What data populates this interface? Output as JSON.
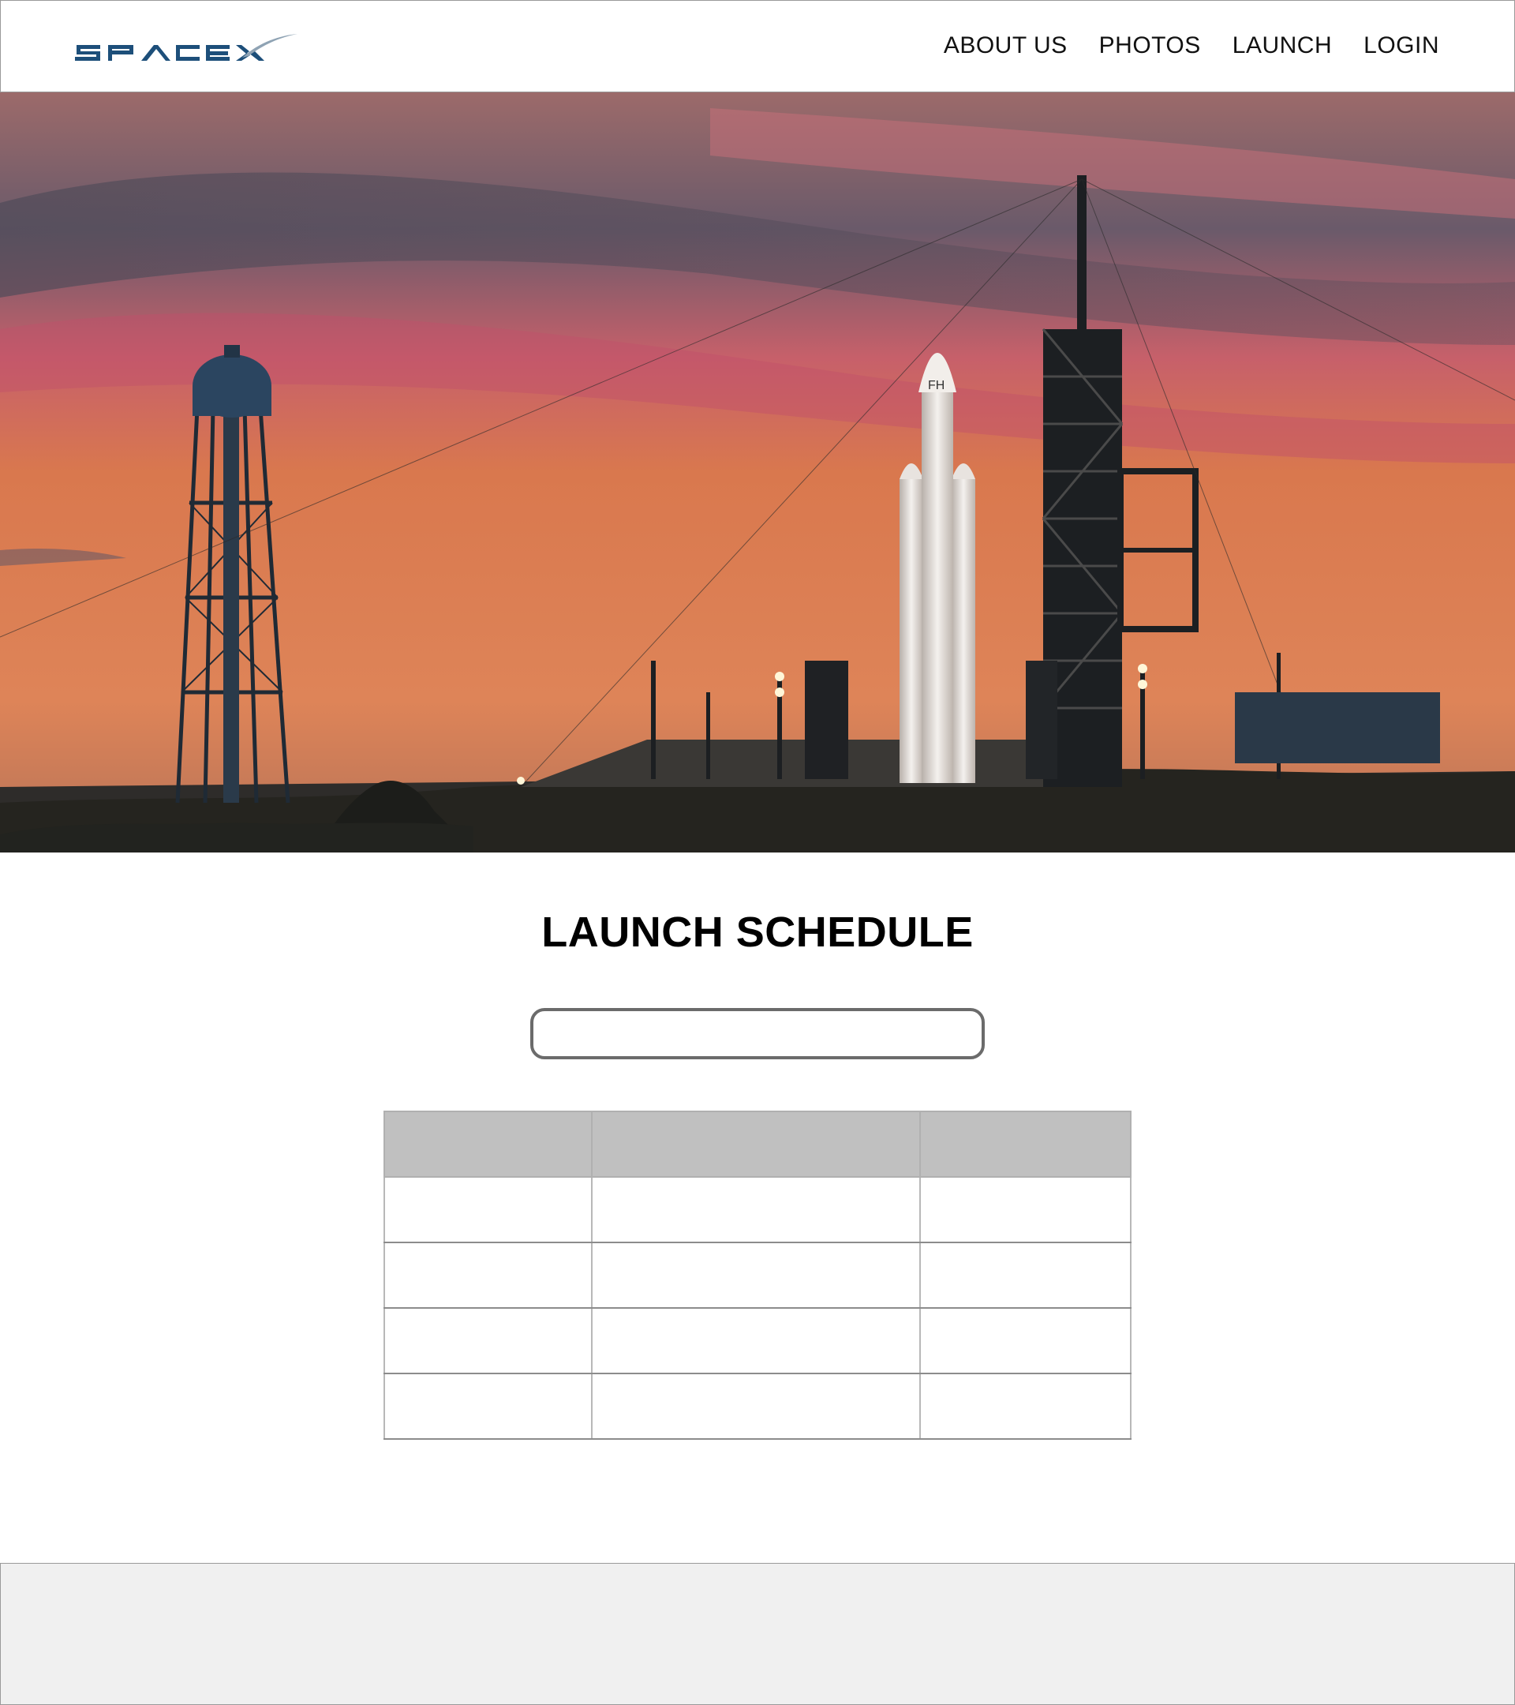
{
  "header": {
    "logo_text": "SPACEX",
    "nav": [
      {
        "label": "ABOUT US"
      },
      {
        "label": "PHOTOS"
      },
      {
        "label": "LAUNCH"
      },
      {
        "label": "LOGIN"
      }
    ]
  },
  "hero": {
    "image_alt": "",
    "colors": {
      "sky_top": "#5b5566",
      "sky_orange": "#df7e4f",
      "sky_pink": "#c8606a",
      "ground": "#2b2a28"
    }
  },
  "main": {
    "title": "LAUNCH SCHEDULE",
    "search": {
      "value": "",
      "placeholder": ""
    },
    "table": {
      "headers": [
        "",
        "",
        ""
      ],
      "rows": [
        [
          "",
          "",
          ""
        ],
        [
          "",
          "",
          ""
        ],
        [
          "",
          "",
          ""
        ],
        [
          "",
          "",
          ""
        ]
      ]
    }
  },
  "footer": {
    "text": ""
  }
}
